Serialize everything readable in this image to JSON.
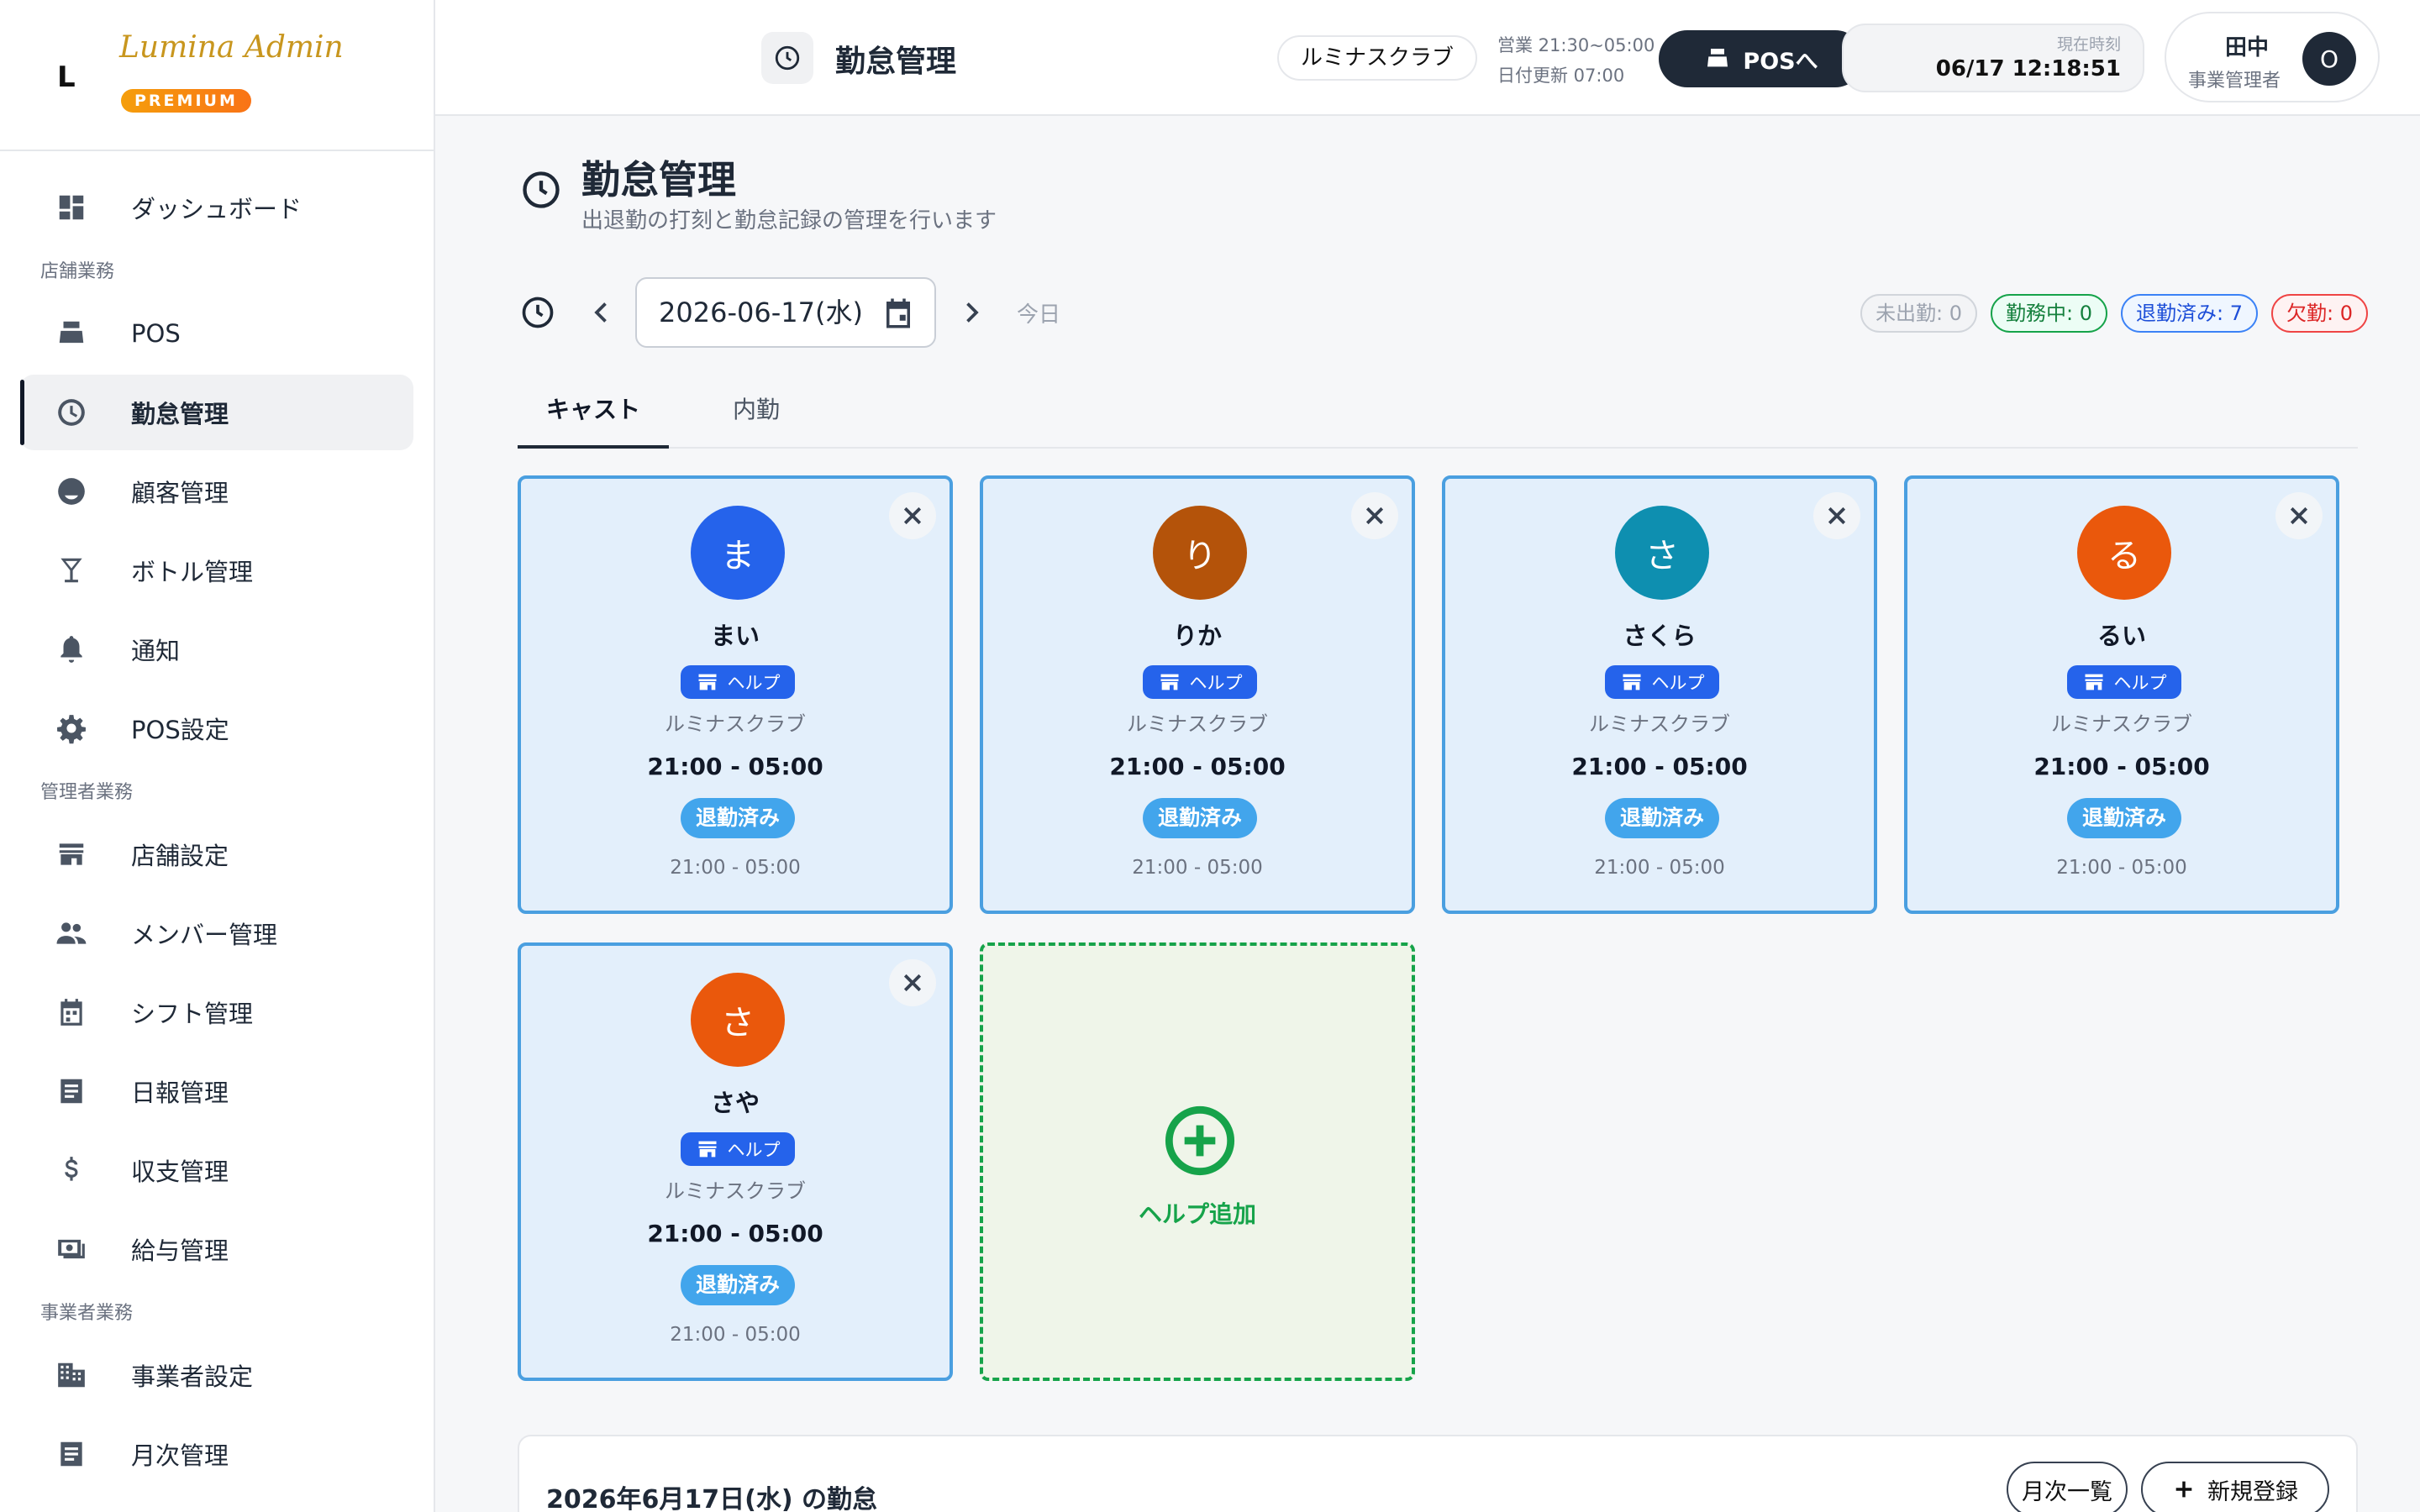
{
  "brand": {
    "mark": "L",
    "name": "Lumina Admin",
    "badge": "PREMIUM"
  },
  "sidebar": {
    "items": [
      {
        "label": "ダッシュボード",
        "icon": "dashboard-icon"
      },
      {
        "section": "店舗業務"
      },
      {
        "label": "POS",
        "icon": "cash-register-icon"
      },
      {
        "label": "勤怠管理",
        "icon": "clock-icon",
        "active": true
      },
      {
        "label": "顧客管理",
        "icon": "face-icon"
      },
      {
        "label": "ボトル管理",
        "icon": "glass-icon"
      },
      {
        "label": "通知",
        "icon": "bell-icon"
      },
      {
        "label": "POS設定",
        "icon": "gear-icon"
      },
      {
        "section": "管理者業務"
      },
      {
        "label": "店舗設定",
        "icon": "store-icon"
      },
      {
        "label": "メンバー管理",
        "icon": "people-icon"
      },
      {
        "label": "シフト管理",
        "icon": "calendar-icon"
      },
      {
        "label": "日報管理",
        "icon": "report-icon"
      },
      {
        "label": "収支管理",
        "icon": "dollar-icon"
      },
      {
        "label": "給与管理",
        "icon": "money-icon"
      },
      {
        "section": "事業者業務"
      },
      {
        "label": "事業者設定",
        "icon": "building-icon"
      },
      {
        "label": "月次管理",
        "icon": "report-icon"
      }
    ]
  },
  "header": {
    "title": "勤怠管理",
    "store": "ルミナスクラブ",
    "hours": "営業 21:30~05:00",
    "date_update": "日付更新 07:00",
    "pos_button": "POSへ",
    "clock_label": "現在時刻",
    "clock_value": "06/17 12:18:51",
    "user_name": "田中",
    "user_role": "事業管理者",
    "avatar": "O"
  },
  "page": {
    "title": "勤怠管理",
    "subtitle": "出退勤の打刻と勤怠記録の管理を行います",
    "date": "2026-06-17(水)",
    "today": "今日",
    "stats": [
      "未出勤: 0",
      "勤務中: 0",
      "退勤済み: 7",
      "欠勤: 0"
    ],
    "tabs": [
      "キャスト",
      "内勤"
    ]
  },
  "cards": [
    {
      "initial": "ま",
      "name": "まい",
      "color": "#2563eb",
      "help": "ヘルプ",
      "store": "ルミナスクラブ",
      "time": "21:00 - 05:00",
      "status": "退勤済み",
      "actual": "21:00 - 05:00"
    },
    {
      "initial": "り",
      "name": "りか",
      "color": "#b4530a",
      "help": "ヘルプ",
      "store": "ルミナスクラブ",
      "time": "21:00 - 05:00",
      "status": "退勤済み",
      "actual": "21:00 - 05:00"
    },
    {
      "initial": "さ",
      "name": "さくら",
      "color": "#0e8fb0",
      "help": "ヘルプ",
      "store": "ルミナスクラブ",
      "time": "21:00 - 05:00",
      "status": "退勤済み",
      "actual": "21:00 - 05:00"
    },
    {
      "initial": "る",
      "name": "るい",
      "color": "#ea580c",
      "help": "ヘルプ",
      "store": "ルミナスクラブ",
      "time": "21:00 - 05:00",
      "status": "退勤済み",
      "actual": "21:00 - 05:00"
    },
    {
      "initial": "さ",
      "name": "さや",
      "color": "#ea580c",
      "help": "ヘルプ",
      "store": "ルミナスクラブ",
      "time": "21:00 - 05:00",
      "status": "退勤済み",
      "actual": "21:00 - 05:00"
    }
  ],
  "add_help": "ヘルプ追加",
  "bottom": {
    "title": "2026年6月17日(水) の勤怠",
    "monthly_button": "月次一覧",
    "new_button": "新規登録"
  }
}
